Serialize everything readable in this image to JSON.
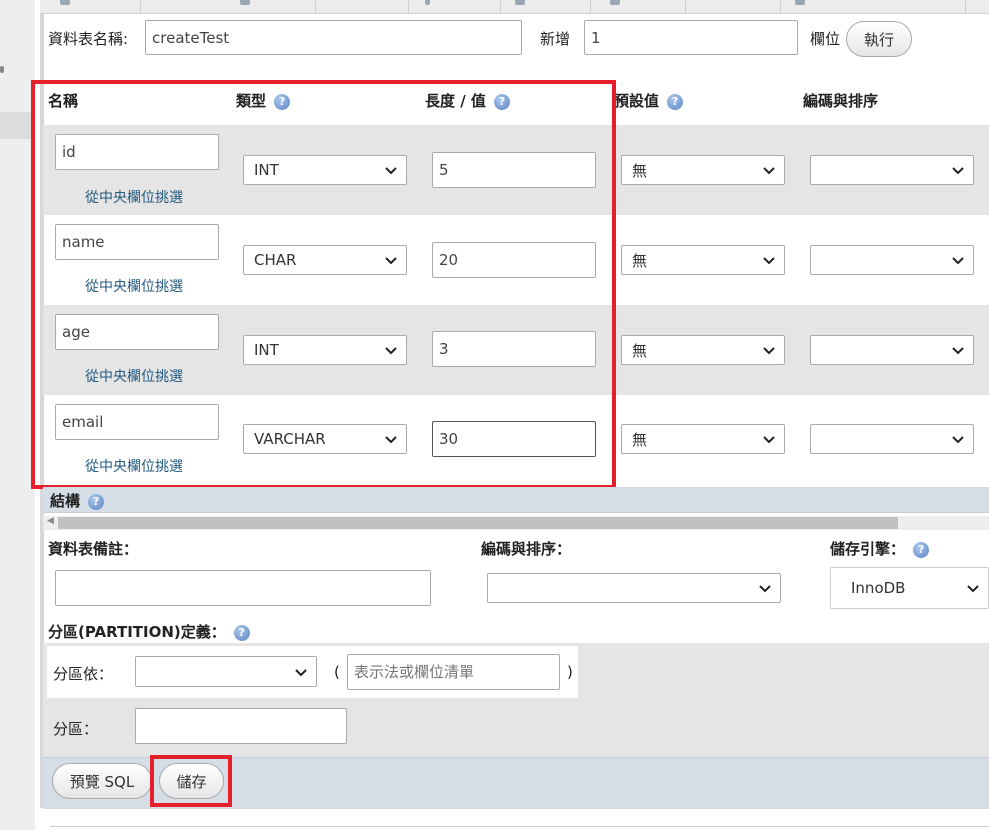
{
  "table_name": {
    "label": "資料表名稱:",
    "value": "createTest"
  },
  "add_columns": {
    "label": "新增",
    "value": "1",
    "unit": "欄位",
    "go_label": "執行"
  },
  "columns_header": {
    "name": "名稱",
    "type": "類型",
    "length": "長度 / 值",
    "default": "預設值",
    "collation": "編碼與排序"
  },
  "pick_link": "從中央欄位挑選",
  "columns": [
    {
      "name": "id",
      "type": "INT",
      "length": "5",
      "default": "無",
      "collation": ""
    },
    {
      "name": "name",
      "type": "CHAR",
      "length": "20",
      "default": "無",
      "collation": ""
    },
    {
      "name": "age",
      "type": "INT",
      "length": "3",
      "default": "無",
      "collation": ""
    },
    {
      "name": "email",
      "type": "VARCHAR",
      "length": "30",
      "default": "無",
      "collation": ""
    }
  ],
  "structure": {
    "title": "結構"
  },
  "table_options": {
    "comment_label": "資料表備註：",
    "comment_value": "",
    "collation_label": "編碼與排序：",
    "collation_value": "",
    "engine_label": "儲存引擎：",
    "engine_value": "InnoDB"
  },
  "partition": {
    "title": "分區(PARTITION)定義：",
    "by_label": "分區依：",
    "by_value": "",
    "open_paren": "(",
    "expr_placeholder": "表示法或欄位清單",
    "close_paren": ")",
    "count_label": "分區：",
    "count_value": ""
  },
  "actions": {
    "preview_sql": "預覽 SQL",
    "save": "儲存"
  },
  "colors": {
    "highlight": "#e5202a",
    "link": "#235a81",
    "help_icon": "#5c86c4",
    "bar": "#d5dde6"
  }
}
